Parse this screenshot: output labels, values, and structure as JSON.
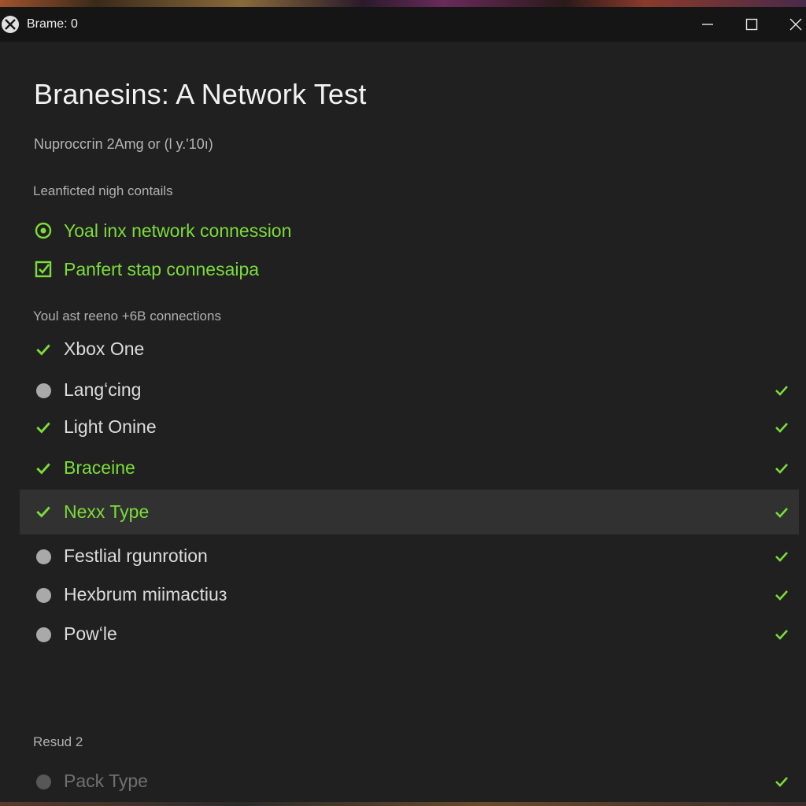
{
  "window": {
    "title": "Brame: 0",
    "logo_icon": "xbox-logo-icon",
    "controls": [
      "minimize-icon",
      "maximize-icon",
      "close-icon"
    ]
  },
  "page": {
    "title": "Branesins: A Network Test",
    "subtitle": "Nuproccгin 2Amg or (l y.'10ı)"
  },
  "status_section": {
    "label": "Leanficted nigh contails",
    "items": [
      {
        "icon": "target-circle-icon",
        "text": "Yoal inx network connession"
      },
      {
        "icon": "checked-box-icon",
        "text": "Panfert stap connesaipa"
      }
    ]
  },
  "connections_section": {
    "label": "Youl ast reeno +6B connections",
    "rows": [
      {
        "label": "Xbox One",
        "lead": "check",
        "trail": false,
        "green": false,
        "selected": false
      },
      {
        "label": "Langʻcing",
        "lead": "dot",
        "trail": true,
        "green": false,
        "selected": false
      },
      {
        "label": "Light Onine",
        "lead": "check",
        "trail": true,
        "green": false,
        "selected": false
      },
      {
        "label": "Braceine",
        "lead": "check",
        "trail": true,
        "green": true,
        "selected": false
      },
      {
        "label": "Nexx Type",
        "lead": "check",
        "trail": true,
        "green": true,
        "selected": true
      },
      {
        "label": "Festlial rgunrotion",
        "lead": "dot",
        "trail": true,
        "green": false,
        "selected": false
      },
      {
        "label": "Hexbrum miimactiuз",
        "lead": "dot",
        "trail": true,
        "green": false,
        "selected": false
      },
      {
        "label": "Powʻle",
        "lead": "dot",
        "trail": true,
        "green": false,
        "selected": false
      }
    ]
  },
  "result_section": {
    "label": "Resuԁ 2",
    "row": {
      "label": "Pack Type",
      "lead": "dot",
      "trail": true
    }
  },
  "colors": {
    "accent_green": "#7bdc3a",
    "background": "#202020",
    "titlebar": "#151515",
    "selected_row": "#313131"
  }
}
